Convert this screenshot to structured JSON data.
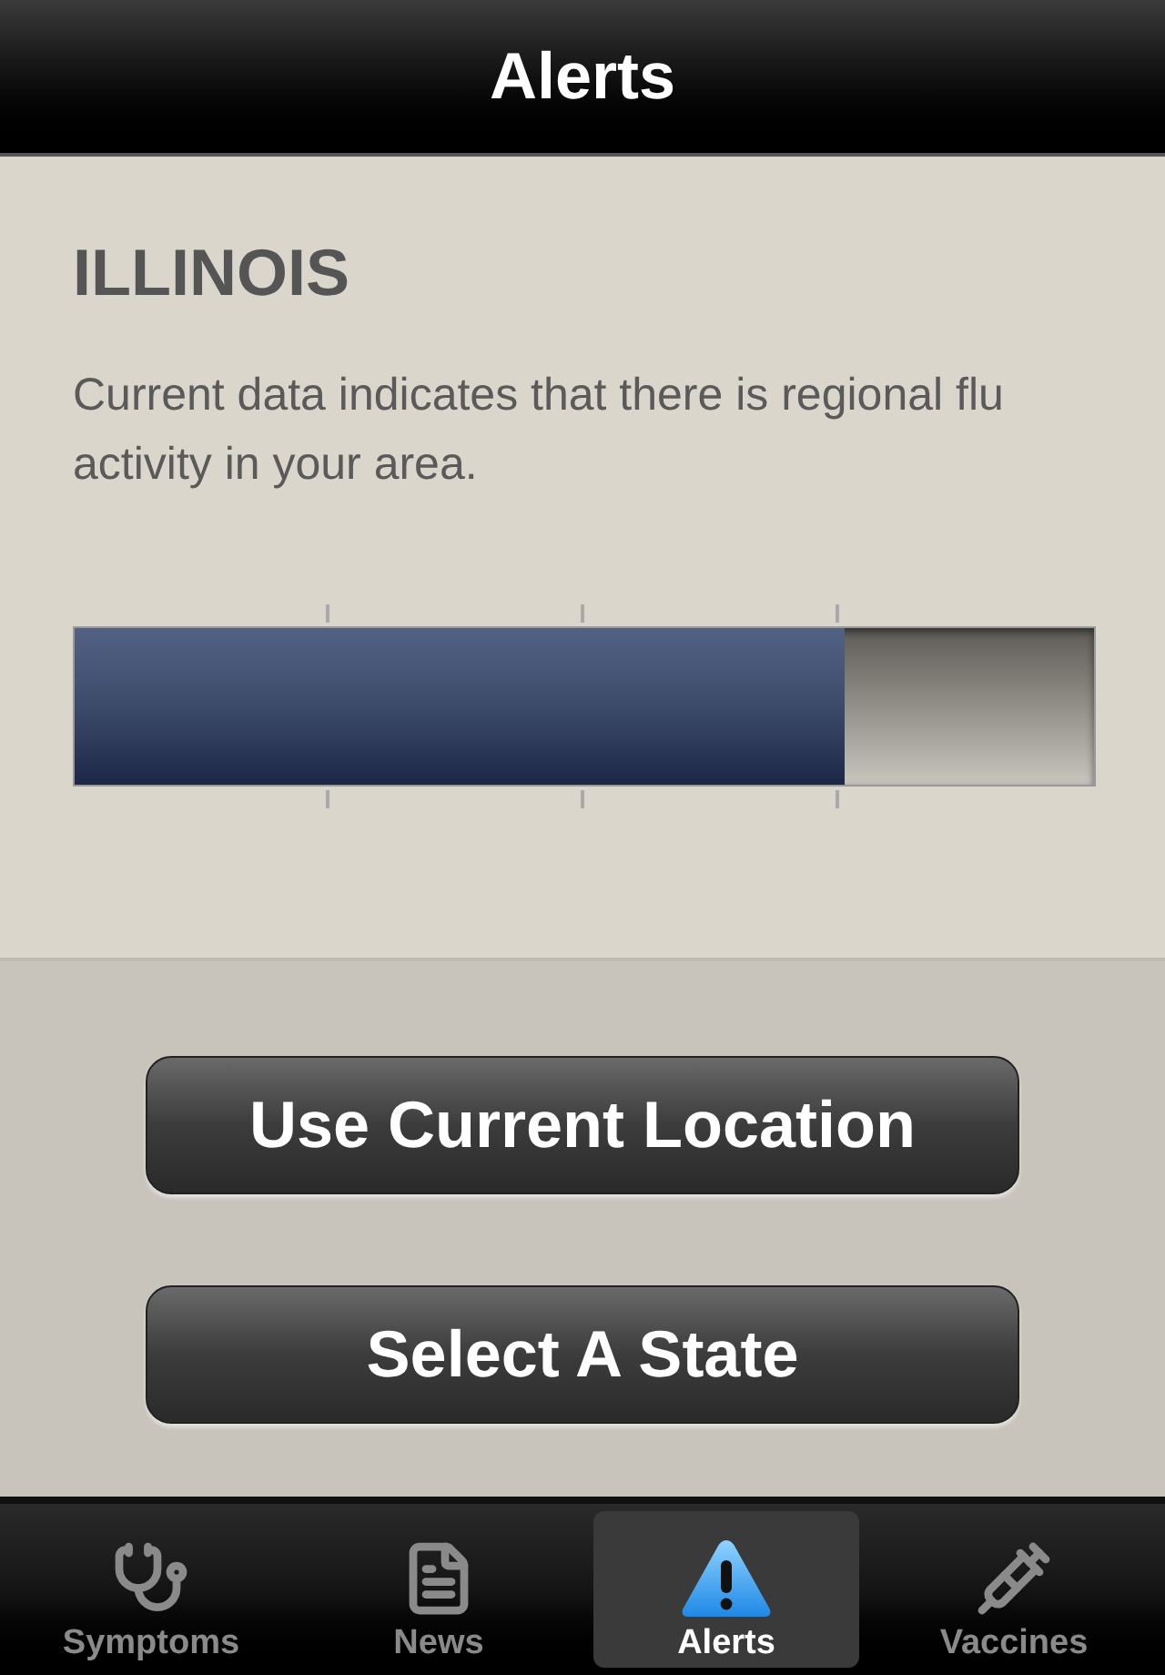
{
  "nav_bar": {
    "title": "Alerts"
  },
  "region": {
    "name": "ILLINOIS",
    "message": "Current data indicates that there is regional flu activity in your area.",
    "meter": {
      "level": 0.755
    }
  },
  "buttons": [
    "Use Current Location",
    "Select A State"
  ],
  "tabs": [
    {
      "label": "Symptoms",
      "kind": "stethoscope",
      "selected": false
    },
    {
      "label": "News",
      "kind": "news",
      "selected": false
    },
    {
      "label": "Alerts",
      "kind": "alert",
      "selected": true
    },
    {
      "label": "Vaccines",
      "kind": "syringe",
      "selected": false
    }
  ]
}
